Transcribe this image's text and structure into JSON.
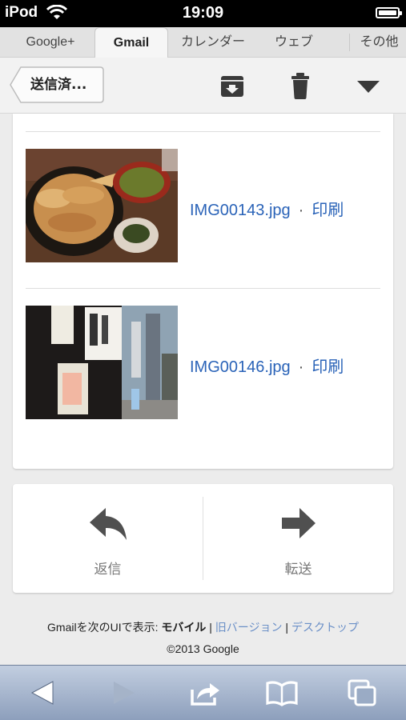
{
  "status_bar": {
    "carrier": "iPod",
    "time": "19:09"
  },
  "tabs": [
    {
      "label": "Google+"
    },
    {
      "label": "Gmail"
    },
    {
      "label": "カレンダー"
    },
    {
      "label": "ウェブ"
    },
    {
      "label": "その他"
    }
  ],
  "toolbar": {
    "back_label": "送信済...",
    "archive_icon": "archive-icon",
    "delete_icon": "trash-icon",
    "more_icon": "dropdown-icon"
  },
  "attachments": [
    {
      "filename": "IMG00143.jpg",
      "separator": "·",
      "action": "印刷"
    },
    {
      "filename": "IMG00146.jpg",
      "separator": "·",
      "action": "印刷"
    }
  ],
  "actions": {
    "reply": "返信",
    "forward": "転送"
  },
  "footer": {
    "prefix": "Gmailを次のUIで表示: ",
    "current": "モバイル",
    "sep1": " | ",
    "old": "旧バージョン",
    "sep2": " | ",
    "desktop": "デスクトップ",
    "copyright": "©2013 Google"
  },
  "colors": {
    "link": "#2a63b8",
    "footer_link": "#6a8fc7",
    "icon": "#3a3a3a"
  }
}
